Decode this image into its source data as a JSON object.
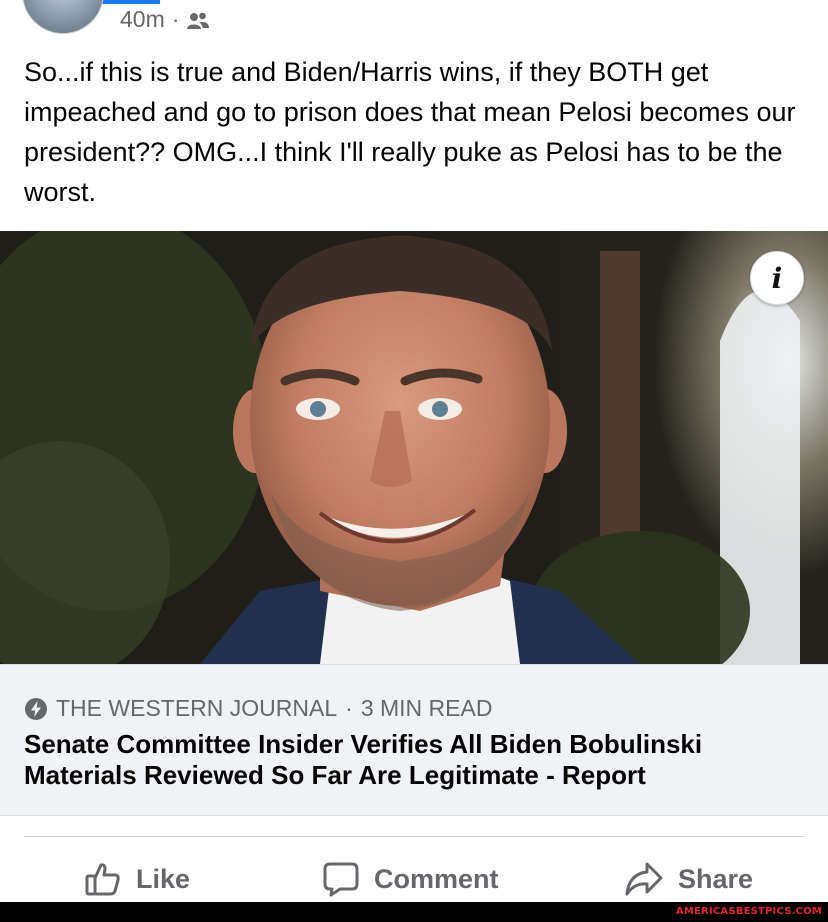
{
  "post": {
    "timestamp": "40m",
    "separator": "·",
    "audience_icon": "friends-icon",
    "text": "So...if this is true and Biden/Harris wins, if they BOTH get impeached and go to prison does that mean Pelosi becomes our president?? OMG...I think I'll really puke as Pelosi has to be the worst."
  },
  "image": {
    "info_label": "i"
  },
  "link_card": {
    "source_icon": "bolt-icon",
    "source": "THE WESTERN JOURNAL",
    "separator": "·",
    "read_time": "3 MIN READ",
    "headline": "Senate Committee Insider Verifies All Biden Bobulinski Materials Reviewed So Far Are Legitimate - Report"
  },
  "actions": {
    "like_label": "Like",
    "comment_label": "Comment",
    "share_label": "Share"
  },
  "footer": {
    "watermark": "AMERICASBESTPICS.COM"
  },
  "colors": {
    "secondary_text": "#65676b",
    "link_card_bg": "#f0f2f5",
    "facebook_blue": "#1877f2",
    "watermark_red": "#e8222b"
  }
}
